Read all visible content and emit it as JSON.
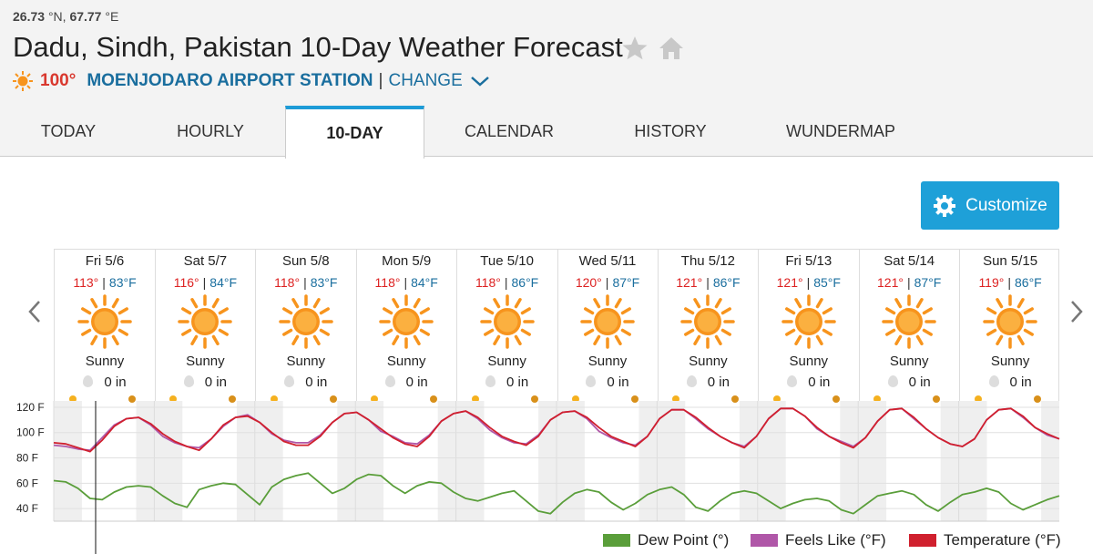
{
  "header": {
    "coords_lat": "26.73",
    "coords_lat_unit": "°N,",
    "coords_lon": "67.77",
    "coords_lon_unit": "°E",
    "title": "Dadu, Sindh, Pakistan 10-Day Weather Forecast",
    "current_temp": "100°",
    "station": "MOENJODARO AIRPORT STATION",
    "separator": "|",
    "change_label": "CHANGE"
  },
  "tabs": [
    "TODAY",
    "HOURLY",
    "10-DAY",
    "CALENDAR",
    "HISTORY",
    "WUNDERMAP"
  ],
  "active_tab": "10-DAY",
  "customize_label": "Customize",
  "days": [
    {
      "name": "Fri 5/6",
      "hi": "113°",
      "lo": "83°F",
      "cond": "Sunny",
      "precip": "0 in"
    },
    {
      "name": "Sat 5/7",
      "hi": "116°",
      "lo": "84°F",
      "cond": "Sunny",
      "precip": "0 in"
    },
    {
      "name": "Sun 5/8",
      "hi": "118°",
      "lo": "83°F",
      "cond": "Sunny",
      "precip": "0 in"
    },
    {
      "name": "Mon 5/9",
      "hi": "118°",
      "lo": "84°F",
      "cond": "Sunny",
      "precip": "0 in"
    },
    {
      "name": "Tue 5/10",
      "hi": "118°",
      "lo": "86°F",
      "cond": "Sunny",
      "precip": "0 in"
    },
    {
      "name": "Wed 5/11",
      "hi": "120°",
      "lo": "87°F",
      "cond": "Sunny",
      "precip": "0 in"
    },
    {
      "name": "Thu 5/12",
      "hi": "121°",
      "lo": "86°F",
      "cond": "Sunny",
      "precip": "0 in"
    },
    {
      "name": "Fri 5/13",
      "hi": "121°",
      "lo": "85°F",
      "cond": "Sunny",
      "precip": "0 in"
    },
    {
      "name": "Sat 5/14",
      "hi": "121°",
      "lo": "87°F",
      "cond": "Sunny",
      "precip": "0 in"
    },
    {
      "name": "Sun 5/15",
      "hi": "119°",
      "lo": "86°F",
      "cond": "Sunny",
      "precip": "0 in"
    }
  ],
  "colors": {
    "accent": "#1ea0d8",
    "hi_temp": "#dd2222",
    "lo_temp": "#1a6e9e",
    "sun": "#f7941d",
    "dew_point": "#5a9e3a",
    "feels_like": "#b057a8",
    "temperature": "#d0202e"
  },
  "chart_data": {
    "type": "line",
    "y_tick_labels": [
      "120 F",
      "100 F",
      "80 F",
      "60 F",
      "40 F"
    ],
    "ylim": [
      30,
      125
    ],
    "days": [
      "Fri 5/6",
      "Sat 5/7",
      "Sun 5/8",
      "Mon 5/9",
      "Tue 5/10",
      "Wed 5/11",
      "Thu 5/12",
      "Fri 5/13",
      "Sat 5/14",
      "Sun 5/15"
    ],
    "grid": true,
    "legend_position": "bottom-right",
    "series": [
      {
        "name": "Dew Point (°)",
        "color": "#5a9e3a",
        "values": [
          62,
          61,
          56,
          48,
          47,
          53,
          57,
          58,
          57,
          50,
          44,
          41,
          55,
          58,
          60,
          59,
          51,
          43,
          57,
          63,
          66,
          68,
          60,
          52,
          56,
          63,
          67,
          66,
          58,
          52,
          58,
          61,
          60,
          53,
          48,
          46,
          49,
          52,
          54,
          46,
          38,
          36,
          45,
          52,
          55,
          53,
          45,
          39,
          44,
          51,
          55,
          57,
          51,
          41,
          38,
          46,
          52,
          54,
          52,
          46,
          40,
          44,
          47,
          48,
          46,
          39,
          36,
          43,
          50,
          52,
          54,
          51,
          43,
          38,
          45,
          51,
          53,
          56,
          53,
          44,
          39,
          43,
          47,
          50
        ]
      },
      {
        "name": "Feels Like (°F)",
        "color": "#b057a8",
        "values": [
          90,
          89,
          87,
          86,
          96,
          106,
          111,
          112,
          106,
          97,
          92,
          89,
          88,
          95,
          105,
          112,
          114,
          108,
          99,
          94,
          92,
          92,
          98,
          108,
          115,
          116,
          110,
          101,
          97,
          92,
          91,
          98,
          109,
          115,
          117,
          111,
          102,
          96,
          92,
          91,
          98,
          110,
          116,
          117,
          111,
          101,
          96,
          92,
          90,
          97,
          111,
          118,
          118,
          111,
          103,
          97,
          92,
          89,
          97,
          111,
          119,
          119,
          113,
          103,
          97,
          93,
          89,
          96,
          109,
          118,
          119,
          111,
          103,
          96,
          91,
          89,
          95,
          110,
          118,
          119,
          112,
          104,
          98,
          95
        ]
      },
      {
        "name": "Temperature (°F)",
        "color": "#d0202e",
        "values": [
          92,
          91,
          88,
          85,
          94,
          105,
          111,
          112,
          107,
          99,
          93,
          89,
          86,
          95,
          106,
          112,
          113,
          108,
          100,
          93,
          90,
          90,
          97,
          108,
          115,
          116,
          110,
          103,
          96,
          91,
          89,
          97,
          109,
          115,
          117,
          112,
          104,
          97,
          93,
          90,
          97,
          110,
          116,
          117,
          112,
          104,
          97,
          93,
          89,
          97,
          111,
          118,
          118,
          112,
          104,
          97,
          92,
          88,
          97,
          111,
          119,
          119,
          113,
          104,
          97,
          92,
          88,
          96,
          109,
          118,
          119,
          112,
          103,
          96,
          91,
          89,
          95,
          110,
          118,
          119,
          113,
          104,
          99,
          95
        ]
      }
    ]
  },
  "legend": {
    "dew": "Dew Point (°)",
    "feels": "Feels Like (°F)",
    "temp": "Temperature (°F)"
  }
}
